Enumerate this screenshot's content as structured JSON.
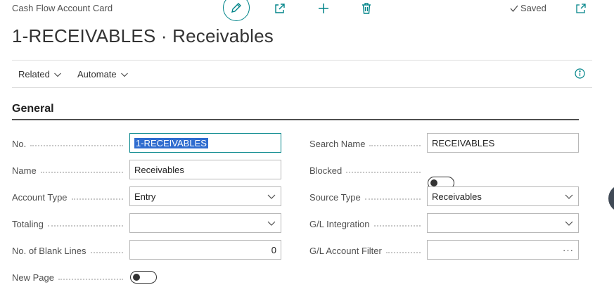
{
  "header": {
    "page_kind": "Cash Flow Account Card",
    "title": "1-RECEIVABLES · Receivables",
    "saved_label": "Saved",
    "icons": [
      "edit-icon",
      "share-icon",
      "new-icon",
      "delete-icon",
      "open-in-new-window-icon"
    ]
  },
  "action_bar": {
    "related_label": "Related",
    "automate_label": "Automate",
    "info_icon": "info-icon"
  },
  "section": {
    "title": "General"
  },
  "left_fields": {
    "no": {
      "label": "No.",
      "value": "1-RECEIVABLES"
    },
    "name": {
      "label": "Name",
      "value": "Receivables"
    },
    "account_type": {
      "label": "Account Type",
      "value": "Entry"
    },
    "totaling": {
      "label": "Totaling",
      "value": ""
    },
    "blank_lines": {
      "label": "No. of Blank Lines",
      "value": "0"
    },
    "new_page": {
      "label": "New Page",
      "value": false
    }
  },
  "right_fields": {
    "search_name": {
      "label": "Search Name",
      "value": "RECEIVABLES"
    },
    "blocked": {
      "label": "Blocked",
      "value": false
    },
    "source_type": {
      "label": "Source Type",
      "value": "Receivables"
    },
    "gl_integration": {
      "label": "G/L Integration",
      "value": ""
    },
    "gl_account_filter": {
      "label": "G/L Account Filter",
      "value": "",
      "assist": "···"
    }
  },
  "colors": {
    "accent": "#008489",
    "selection": "#2f6ccf",
    "text": "#212121",
    "muted": "#505050"
  }
}
